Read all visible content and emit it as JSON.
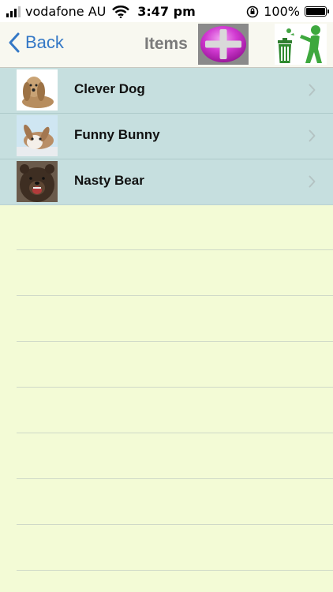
{
  "status_bar": {
    "carrier": "vodafone AU",
    "time": "3:47 pm",
    "battery_text": "100%",
    "icons": [
      "signal-icon",
      "wifi-icon",
      "orientation-lock-icon",
      "battery-icon"
    ]
  },
  "nav": {
    "back_label": "Back",
    "title": "Items",
    "add_icon": "plus-icon",
    "trash_icon": "trash-icon",
    "back_color": "#3478c6",
    "add_color": "#c51ec5"
  },
  "list": {
    "items": [
      {
        "label": "Clever Dog",
        "thumbnail": "dog-thumbnail"
      },
      {
        "label": "Funny Bunny",
        "thumbnail": "bunny-thumbnail"
      },
      {
        "label": "Nasty Bear",
        "thumbnail": "bear-thumbnail"
      }
    ],
    "row_color": "#c6dfdf",
    "background_color": "#f3fbd6"
  }
}
